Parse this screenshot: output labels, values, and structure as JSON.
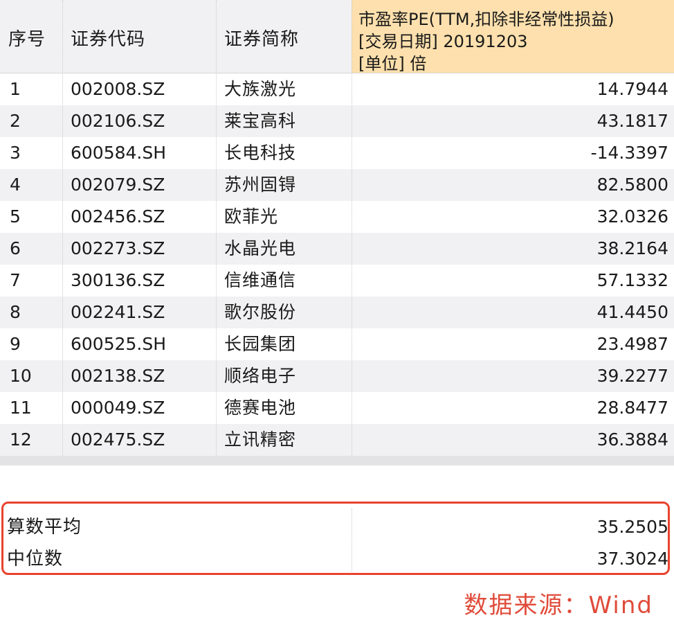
{
  "header": {
    "col_no": "序号",
    "col_code": "证券代码",
    "col_name": "证券简称",
    "col_pe_line1": "市盈率PE(TTM,扣除非经常性损益)",
    "col_pe_line2": "[交易日期] 20191203",
    "col_pe_line3": "[单位] 倍"
  },
  "rows": [
    {
      "no": "1",
      "code": "002008.SZ",
      "name": "大族激光",
      "pe": "14.7944"
    },
    {
      "no": "2",
      "code": "002106.SZ",
      "name": "莱宝高科",
      "pe": "43.1817"
    },
    {
      "no": "3",
      "code": "600584.SH",
      "name": "长电科技",
      "pe": "-14.3397"
    },
    {
      "no": "4",
      "code": "002079.SZ",
      "name": "苏州固锝",
      "pe": "82.5800"
    },
    {
      "no": "5",
      "code": "002456.SZ",
      "name": "欧菲光",
      "pe": "32.0326"
    },
    {
      "no": "6",
      "code": "002273.SZ",
      "name": "水晶光电",
      "pe": "38.2164"
    },
    {
      "no": "7",
      "code": "300136.SZ",
      "name": "信维通信",
      "pe": "57.1332"
    },
    {
      "no": "8",
      "code": "002241.SZ",
      "name": "歌尔股份",
      "pe": "41.4450"
    },
    {
      "no": "9",
      "code": "600525.SH",
      "name": "长园集团",
      "pe": "23.4987"
    },
    {
      "no": "10",
      "code": "002138.SZ",
      "name": "顺络电子",
      "pe": "39.2277"
    },
    {
      "no": "11",
      "code": "000049.SZ",
      "name": "德赛电池",
      "pe": "28.8477"
    },
    {
      "no": "12",
      "code": "002475.SZ",
      "name": "立讯精密",
      "pe": "36.3884"
    }
  ],
  "summary": {
    "mean_label": "算数平均",
    "mean_value": "35.2505",
    "median_label": "中位数",
    "median_value": "37.3024"
  },
  "source": "数据来源：Wind",
  "colors": {
    "header_bg": "#f1f1f3",
    "pe_header_bg": "#fde0ad",
    "highlight_border": "#e8432e",
    "source_text": "#e04b3a"
  }
}
